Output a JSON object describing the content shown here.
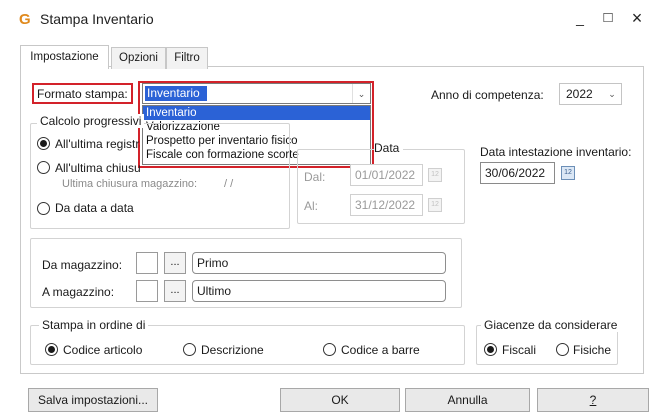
{
  "window": {
    "title": "Stampa Inventario",
    "minimize": "_",
    "maximize": "□",
    "close": "×"
  },
  "tabs": [
    {
      "label": "Impostazione"
    },
    {
      "label": "Opzioni"
    },
    {
      "label": "Filtro"
    }
  ],
  "formato": {
    "label": "Formato stampa:",
    "value": "Inventario",
    "options": [
      "Inventario",
      "Valorizzazione",
      "Prospetto per inventario fisico",
      "Fiscale con formazione scorte"
    ]
  },
  "anno": {
    "label": "Anno di competenza:",
    "value": "2022"
  },
  "calcolo": {
    "title": "Calcolo progressivi",
    "option1": "All'ultima registrazione",
    "option2": "All'ultima chiusura",
    "ultima_chiusura_label": "Ultima chiusura magazzino:",
    "ultima_chiusura_value": "/ /",
    "option3": "Da data a data"
  },
  "data": {
    "title": "Data",
    "dal_label": "Dal:",
    "dal_value": "01/01/2022",
    "al_label": "Al:",
    "al_value": "31/12/2022"
  },
  "intestazione": {
    "label": "Data intestazione inventario:",
    "value": "30/06/2022"
  },
  "magazzino": {
    "da_label": "Da magazzino:",
    "da_value": "Primo",
    "a_label": "A magazzino:",
    "a_value": "Ultimo",
    "browse": "..."
  },
  "ordine": {
    "title": "Stampa in ordine di",
    "opt1": "Codice articolo",
    "opt2": "Descrizione",
    "opt3": "Codice a barre"
  },
  "giacenze": {
    "title": "Giacenze da considerare",
    "opt1": "Fiscali",
    "opt2": "Fisiche"
  },
  "buttons": {
    "salva": "Salva impostazioni...",
    "ok": "OK",
    "annulla": "Annulla",
    "help": "?"
  },
  "icons": {
    "app": "G",
    "calendar": "12"
  }
}
